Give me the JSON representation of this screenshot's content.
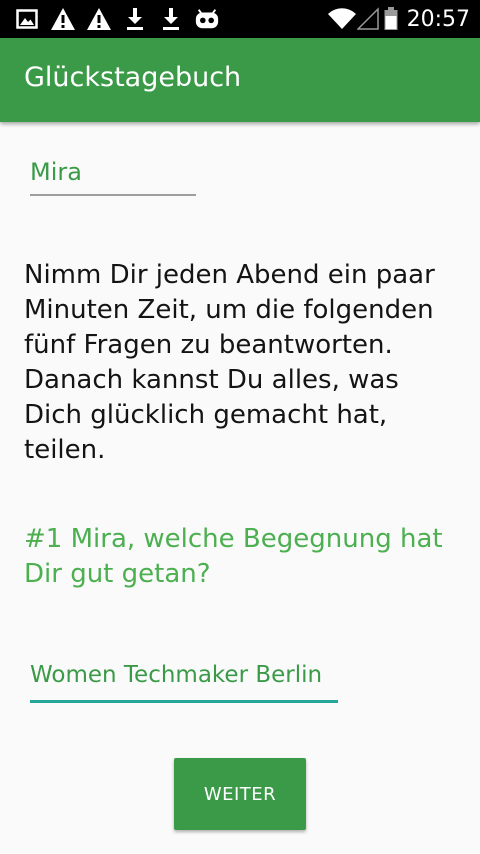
{
  "status_bar": {
    "icons_left": [
      "image-icon",
      "warning-icon",
      "warning-icon",
      "download-icon",
      "download-icon",
      "android-robot-icon"
    ],
    "icons_right": [
      "wifi-icon",
      "signal-icon",
      "battery-icon"
    ],
    "time": "20:57"
  },
  "app_bar": {
    "title": "Glückstagebuch",
    "color": "#3b9a48"
  },
  "form": {
    "name_value": "Mira",
    "intro_text": "Nimm Dir jeden Abend ein paar Minuten Zeit, um die folgenden fünf Fragen zu beantworten. Danach kannst Du alles, was Dich glücklich gemacht hat, teilen.",
    "question": "#1 Mira, welche Begegnung hat Dir gut getan?",
    "answer_value": "Women Techmaker Berlin",
    "next_label": "WEITER"
  },
  "colors": {
    "accent_green": "#4caf50",
    "input_underline_active": "#26a69a"
  }
}
